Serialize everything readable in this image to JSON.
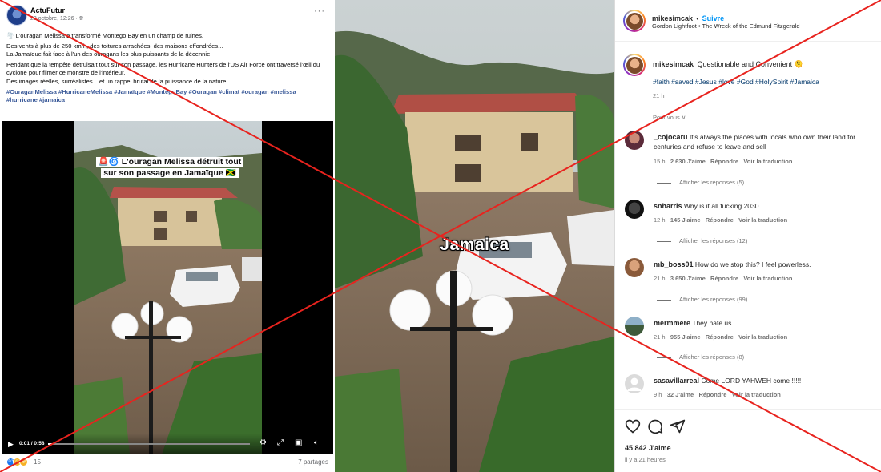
{
  "facebook": {
    "page_name": "ActuFutur",
    "date": "23 octobre, 12:26 · ",
    "globe_icon": "globe-icon",
    "more_label": "···",
    "text_line1": "🌪️ L'ouragan Melissa a transformé Montego Bay en un champ de ruines.",
    "text_line2": "Des vents à plus de 250 km/h, des toitures arrachées, des maisons effondrées...",
    "text_line3": "La Jamaïque fait face à l'un des ouragans les plus puissants de la décennie.",
    "text_line4": "Pendant que la tempête détruisait tout sur son passage, les Hurricane Hunters de l'US Air Force ont traversé l'œil du cyclone pour filmer ce monstre de l'intérieur.",
    "text_line5": "Des images réelles, surréalistes... et un rappel brutal de la puissance de la nature.",
    "hashtags": "#OuraganMelissa #HurricaneMelissa #Jamaïque #MontegoBay #Ouragan #climat #ouragan #melissa #hurricane #jamaica",
    "video_caption_line1": "🚨🌀 L'ouragan Melissa détruit tout",
    "video_caption_line2": "sur son passage en Jamaïque 🇯🇲",
    "video_time": "0:01 / 0:58",
    "video_progress": 0.02,
    "reaction_count": "15",
    "shares": "7 partages"
  },
  "video_label": "Jamaica",
  "instagram": {
    "username": "mikesimcak",
    "dot": "•",
    "follow_label": "Suivre",
    "audio": "Gordon Lightfoot • The Wreck of the Edmund Fitzgerald",
    "caption_text": "Questionable and Convenient 🫠",
    "caption_hashtags": "#faith #saved #Jesus #love #God #HolySpirit #Jamaica",
    "caption_time": "21 h",
    "see_translation": "Pour vous ∨",
    "comments": [
      {
        "user": "_cojocaru",
        "text": "It's always the places with locals who own their land",
        "text2": "for centuries and refuse to leave and sell",
        "time": "15 h",
        "likes": "2 630 J'aime",
        "reply": "Répondre",
        "translate": "Voir la traduction",
        "replies": "Afficher les réponses (5)"
      },
      {
        "user": "snharris",
        "text": "Why is it all fucking 2030.",
        "time": "12 h",
        "likes": "145 J'aime",
        "reply": "Répondre",
        "translate": "Voir la traduction",
        "replies": "Afficher les réponses (12)"
      },
      {
        "user": "mb_boss01",
        "text": "How do we stop this? I feel powerless.",
        "time": "21 h",
        "likes": "3 650 J'aime",
        "reply": "Répondre",
        "translate": "Voir la traduction",
        "replies": "Afficher les réponses (99)"
      },
      {
        "user": "mermmere",
        "text": "They hate us.",
        "time": "21 h",
        "likes": "955 J'aime",
        "reply": "Répondre",
        "translate": "Voir la traduction",
        "replies": "Afficher les réponses (8)"
      },
      {
        "user": "sasavillarreal",
        "text": "Come LORD YAHWEH come !!!!!",
        "time": "9 h",
        "likes": "32 J'aime",
        "reply": "Répondre",
        "translate": "Voir la traduction"
      }
    ],
    "likes_total": "45 842 J'aime",
    "posted_ago": "il y a 21 heures",
    "action_icons": [
      "heart-icon",
      "comment-icon",
      "share-icon"
    ]
  },
  "colors": {
    "fb_link": "#385898",
    "ig_follow": "#0095f6",
    "ig_hashtag": "#00376b",
    "cross_red": "#e8231e"
  }
}
